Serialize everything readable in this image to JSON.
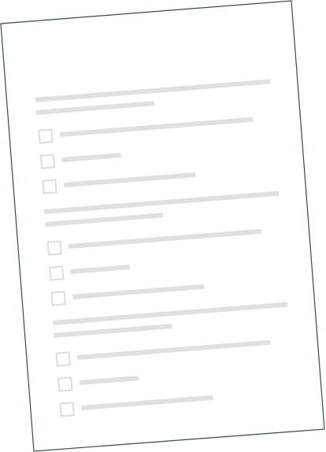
{
  "document": {
    "paper_color": "#ffffff",
    "border_color": "#2f4f4a",
    "placeholder_color": "#e0e0e0",
    "checkbox_border_color": "#dcdcdc",
    "sections": [
      {
        "questions": [
          {
            "checked": false
          },
          {
            "checked": false
          },
          {
            "checked": false
          }
        ]
      },
      {
        "questions": [
          {
            "checked": false
          },
          {
            "checked": false
          },
          {
            "checked": false
          }
        ]
      },
      {
        "questions": [
          {
            "checked": false
          },
          {
            "checked": false
          },
          {
            "checked": false
          }
        ]
      }
    ]
  }
}
